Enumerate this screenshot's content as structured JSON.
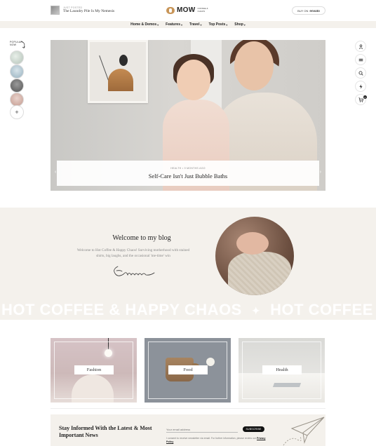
{
  "header": {
    "recent_kicker": "Just Posted",
    "recent_title": "The Laundry Pile Is My Nemesis",
    "logo_word": "MOW",
    "logo_sub": "COFFEE & CHAOS",
    "buy_prefix": "BUY ON",
    "buy_brand": "envato"
  },
  "nav": {
    "items": [
      {
        "label": "Home & Demos"
      },
      {
        "label": "Features"
      },
      {
        "label": "Travel"
      },
      {
        "label": "Top Posts"
      },
      {
        "label": "Shop"
      }
    ]
  },
  "sidebar_left": {
    "label": "POPULAR NOW",
    "plus": "+"
  },
  "sidebar_right": {
    "cart_count": "0"
  },
  "hero": {
    "meta": "HEALTH  •  9 months ago",
    "title": "Self-Care Isn't Just Bubble Baths",
    "prev": "‹",
    "next": "›"
  },
  "about": {
    "title": "Welcome to my blog",
    "text": "Welcome to Hot Coffee & Happy Chaos! Surviving motherhood with stained shirts, big laughs, and the occasional 'me-time' win",
    "marquee": "HOT COFFEE & HAPPY CHAOS",
    "marquee_sep": "✦",
    "marquee_2": "HOT COFFEE"
  },
  "categories": [
    {
      "label": "Fashion"
    },
    {
      "label": "Food"
    },
    {
      "label": "Health"
    }
  ],
  "newsletter": {
    "title": "Stay Informed With the Latest & Most Important News",
    "placeholder": "Your email address",
    "button": "SUBSCRIBE",
    "consent_text": "I consent to receive newsletter via email. For further information, please review our",
    "consent_link": "Privacy Policy"
  },
  "colors": {
    "accent": "#c89558",
    "section_bg": "#f4f1ec",
    "button_bg": "#111111"
  }
}
